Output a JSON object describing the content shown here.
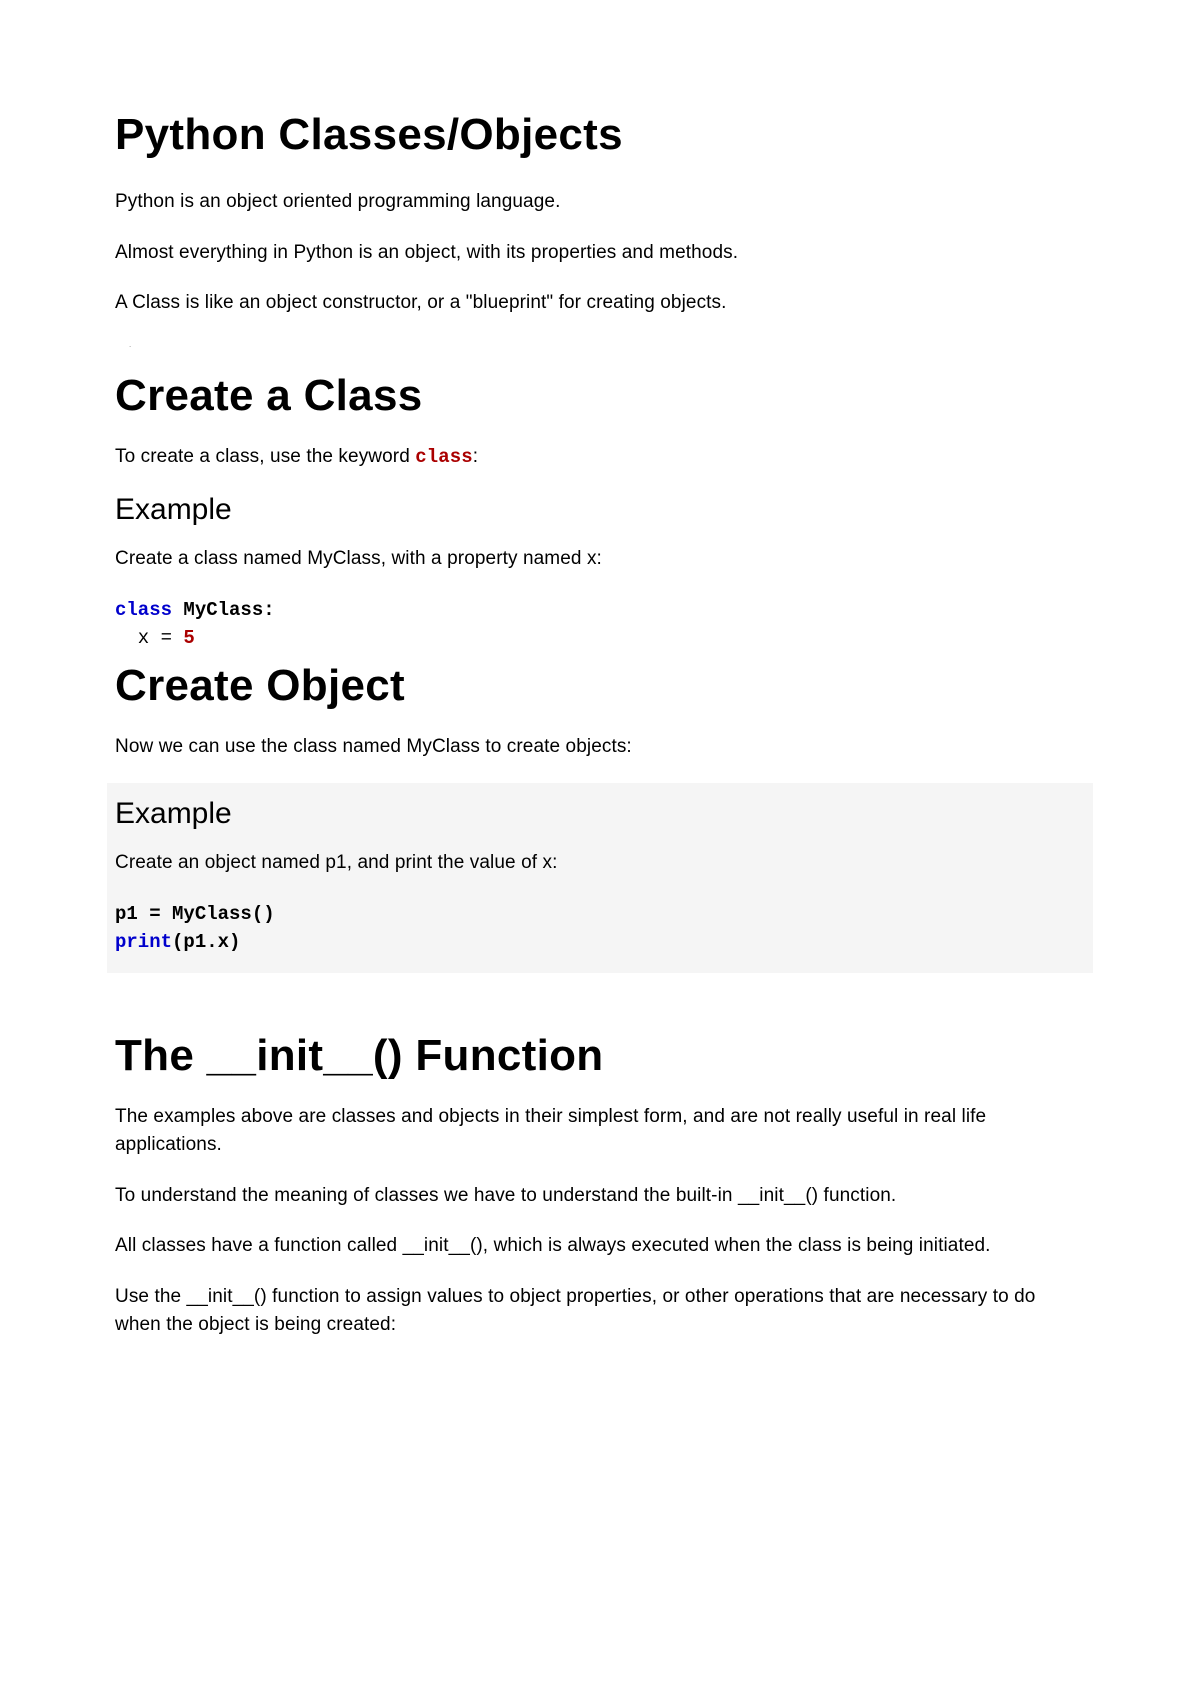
{
  "title1": "Python Classes/Objects",
  "intro1": "Python is an object oriented programming language.",
  "intro2": "Almost everything in Python is an object, with its properties and methods.",
  "intro3": "A Class is like an object constructor, or a \"blueprint\" for creating objects.",
  "dot": ".",
  "title2": "Create a Class",
  "create_class_intro_before": "To create a class, use the keyword ",
  "create_class_keyword": "class",
  "create_class_intro_after": ":",
  "example_label": "Example",
  "example1_desc": "Create a class named MyClass, with a property named x:",
  "code1": {
    "line1_kw": "class",
    "line1_rest": " MyClass:",
    "line2_indent": "  x = ",
    "line2_val": "5"
  },
  "title3": "Create Object",
  "create_object_intro": "Now we can use the class named MyClass to create objects:",
  "example2_desc": "Create an object named p1, and print the value of x:",
  "code2": {
    "line1": "p1 = MyClass()",
    "line2_print": "print",
    "line2_rest": "(p1.x)"
  },
  "title4": "The __init__() Function",
  "init1": "The examples above are classes and objects in their simplest form, and are not really useful in real life applications.",
  "init2": "To understand the meaning of classes we have to understand the built-in __init__() function.",
  "init3": "All classes have a function called __init__(), which is always executed when the class is being initiated.",
  "init4": "Use the __init__() function to assign values to object properties, or other operations that are necessary to do when the object is being created:"
}
